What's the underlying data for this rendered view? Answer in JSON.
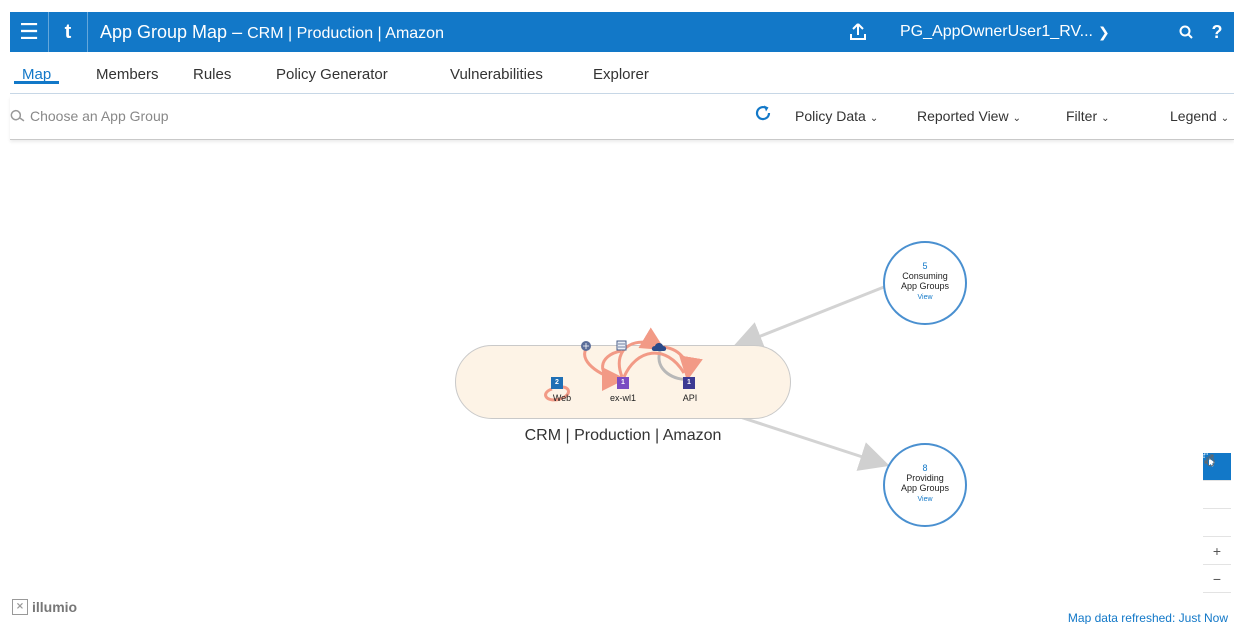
{
  "topbar": {
    "menu_icon": "hamburger-icon",
    "back_icon": "back-icon",
    "title_main": "App Group Map",
    "title_sep": "–",
    "title_sub": "CRM | Production | Amazon",
    "upload_icon": "upload-icon",
    "user": "PG_AppOwnerUser1_RV...",
    "help": "?"
  },
  "tabs": [
    {
      "label": "Map",
      "active": true
    },
    {
      "label": "Members",
      "active": false
    },
    {
      "label": "Rules",
      "active": false
    },
    {
      "label": "Policy Generator",
      "active": false
    },
    {
      "label": "Vulnerabilities",
      "active": false
    },
    {
      "label": "Explorer",
      "active": false
    }
  ],
  "filterbar": {
    "search_placeholder": "Choose an App Group",
    "policy_data": "Policy Data",
    "reported_view": "Reported View",
    "filter": "Filter",
    "legend": "Legend"
  },
  "map": {
    "group_name": "CRM | Production | Amazon",
    "nodes": [
      {
        "label": "Web",
        "count": "2"
      },
      {
        "label": "ex-wl1",
        "count": "1"
      },
      {
        "label": "API",
        "count": "1"
      }
    ],
    "consuming": {
      "count": "5",
      "line1": "Consuming",
      "line2": "App Groups",
      "view": "View"
    },
    "providing": {
      "count": "8",
      "line1": "Providing",
      "line2": "App Groups",
      "view": "View"
    }
  },
  "tools": {
    "plus": "+",
    "minus": "−"
  },
  "footer": {
    "logo": "illumio",
    "refreshed": "Map data refreshed: Just Now"
  },
  "colors": {
    "accent": "#1278c8",
    "group_fill": "#fdf3e6",
    "flow_line": "#f0a090"
  }
}
